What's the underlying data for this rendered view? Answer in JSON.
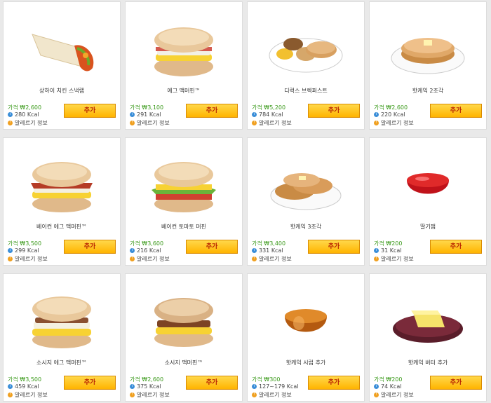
{
  "labels": {
    "price_prefix": "가격 ₩",
    "allergy": "알레르기 정보",
    "add_button": "추가"
  },
  "items": [
    {
      "name": "상하이 치킨 스낵랩",
      "price": "2,600",
      "kcal": "280 Kcal",
      "image": "wrap"
    },
    {
      "name": "에그 맥머핀™",
      "price": "3,100",
      "kcal": "291 Kcal",
      "image": "muffin-egg"
    },
    {
      "name": "디럭스 브렉퍼스트",
      "price": "5,200",
      "kcal": "784 Kcal",
      "image": "deluxe-plate"
    },
    {
      "name": "핫케익 2조각",
      "price": "2,600",
      "kcal": "220 Kcal",
      "image": "hotcake-2"
    },
    {
      "name": "베이컨 에그 맥머핀™",
      "price": "3,500",
      "kcal": "299 Kcal",
      "image": "muffin-bacon"
    },
    {
      "name": "베이컨 토마토 머핀",
      "price": "3,600",
      "kcal": "216 Kcal",
      "image": "muffin-tomato"
    },
    {
      "name": "핫케익 3조각",
      "price": "3,400",
      "kcal": "331 Kcal",
      "image": "hotcake-3"
    },
    {
      "name": "딸기잼",
      "price": "200",
      "kcal": "31 Kcal",
      "image": "jam"
    },
    {
      "name": "소시지 에그 맥머핀™",
      "price": "3,500",
      "kcal": "459 Kcal",
      "image": "muffin-sausage-egg"
    },
    {
      "name": "소시지 맥머핀™",
      "price": "2,600",
      "kcal": "375 Kcal",
      "image": "muffin-sausage"
    },
    {
      "name": "핫케익 시럽 추가",
      "price": "300",
      "kcal": "127~179 Kcal",
      "image": "syrup"
    },
    {
      "name": "핫케익 버터 추가",
      "price": "200",
      "kcal": "74 Kcal",
      "image": "butter"
    }
  ]
}
